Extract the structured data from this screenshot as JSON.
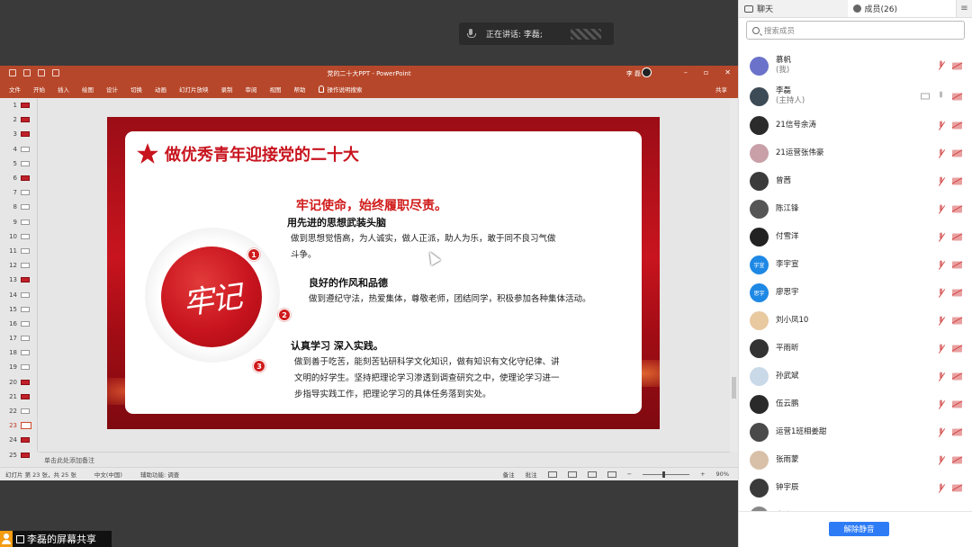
{
  "speaker_banner": {
    "text": "正在讲话: 李磊;"
  },
  "ppt": {
    "doc_title": "党的二十大PPT - PowerPoint",
    "user_name": "李 磊",
    "ribbon_tabs": [
      "文件",
      "开始",
      "插入",
      "绘图",
      "设计",
      "切换",
      "动画",
      "幻灯片放映",
      "录制",
      "审阅",
      "视图",
      "帮助"
    ],
    "tell_me": "操作说明搜索",
    "share": "共享",
    "thumb_count": 25,
    "current_slide": 23,
    "notes_placeholder": "单击此处添加备注",
    "status": {
      "slide_info": "幻灯片 第 23 张，共 25 张",
      "language": "中文(中国)",
      "accessibility": "辅助功能: 调查",
      "notes": "备注",
      "comments": "批注",
      "zoom": "90%"
    }
  },
  "slide": {
    "title": "做优秀青年迎接党的二十大",
    "subtitle": "牢记使命，始终履职尽责。",
    "seal_text": "牢记",
    "sections": [
      {
        "num": "1",
        "head": "用先进的思想武装头脑",
        "body_lines": [
          "做到思想觉悟高，为人诚实，做人正派，助人为乐，敢于同不良习气做",
          "斗争。"
        ]
      },
      {
        "num": "2",
        "head": "良好的作风和品德",
        "body_lines": [
          "做到遵纪守法，热爱集体，尊敬老师，团结同学，积极参加各种集体活动。"
        ]
      },
      {
        "num": "3",
        "head": "认真学习 深入实践。",
        "body_lines": [
          "做到善于吃苦，能刻苦钻研科学文化知识，做有知识有文化守纪律、讲",
          "文明的好学生。坚持把理论学习渗透到调查研究之中，使理论学习进一",
          "步指导实践工作，把理论学习的具体任务落到实处。"
        ]
      }
    ]
  },
  "share_bar": {
    "label": "李磊的屏幕共享"
  },
  "panel": {
    "tab_chat": "聊天",
    "tab_members": "成员(26)",
    "search_placeholder": "搜索成员",
    "members": [
      {
        "name": "慕帆",
        "sub": "(我)",
        "avatar_color": "#6a73c9",
        "type": "tall"
      },
      {
        "name": "李磊",
        "sub": "(主持人)",
        "avatar_color": "#3d4b57",
        "type": "host"
      },
      {
        "name": "21信号余涛",
        "avatar_color": "#2b2b2b"
      },
      {
        "name": "21运营张伟豪",
        "avatar_color": "#c9a0a8"
      },
      {
        "name": "曾茜",
        "avatar_color": "#3b3b3b"
      },
      {
        "name": "陈江锋",
        "avatar_color": "#555"
      },
      {
        "name": "付雪洋",
        "avatar_color": "#222"
      },
      {
        "name": "李宇宣",
        "avatar_color": "#1e88e5",
        "avatar_text": "宇宣"
      },
      {
        "name": "廖思宇",
        "avatar_color": "#1e88e5",
        "avatar_text": "思宇"
      },
      {
        "name": "刘小凤10",
        "avatar_color": "#e8c9a0"
      },
      {
        "name": "平雨昕",
        "avatar_color": "#333"
      },
      {
        "name": "孙武斌",
        "avatar_color": "#c9d9e8"
      },
      {
        "name": "伍云鹏",
        "avatar_color": "#2a2a2a"
      },
      {
        "name": "运营1班相姜甜",
        "avatar_color": "#4a4a4a"
      },
      {
        "name": "张雨蒙",
        "avatar_color": "#d8c0a8"
      },
      {
        "name": "钟宇辰",
        "avatar_color": "#3a3a3a"
      },
      {
        "name": "宋晓巴",
        "avatar_color": "#888"
      }
    ],
    "unmute_label": "解除静音"
  }
}
